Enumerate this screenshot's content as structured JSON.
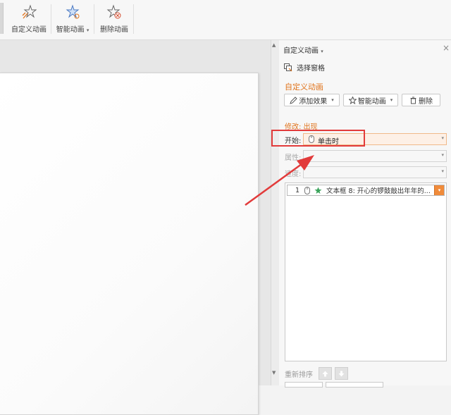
{
  "ribbon": {
    "buttons": [
      {
        "label": "自定义动画",
        "icon": "custom-animation-icon"
      },
      {
        "label": "智能动画",
        "icon": "smart-animation-icon",
        "has_dropdown": true
      },
      {
        "label": "删除动画",
        "icon": "delete-animation-icon"
      }
    ]
  },
  "panel": {
    "title": "自定义动画",
    "title_caret": "▾",
    "close": "×",
    "selection_pane": "选择窗格",
    "section_title": "自定义动画",
    "add_effect": "添加效果",
    "smart_animation": "智能动画",
    "delete": "删除",
    "modify_title": "修改: 出现",
    "start_label": "开始:",
    "start_value": "单击时",
    "property_label": "属性:",
    "speed_label": "速度:",
    "animation_list": [
      {
        "order": "1",
        "text": "文本框 8: 开心的锣鼓敲出年年的..."
      }
    ],
    "reorder_label": "重新排序"
  },
  "colors": {
    "accent": "#e0741d",
    "highlight_box": "#e23b3b",
    "arrow": "#e23b3b",
    "star_icon": "#3aa35a"
  }
}
